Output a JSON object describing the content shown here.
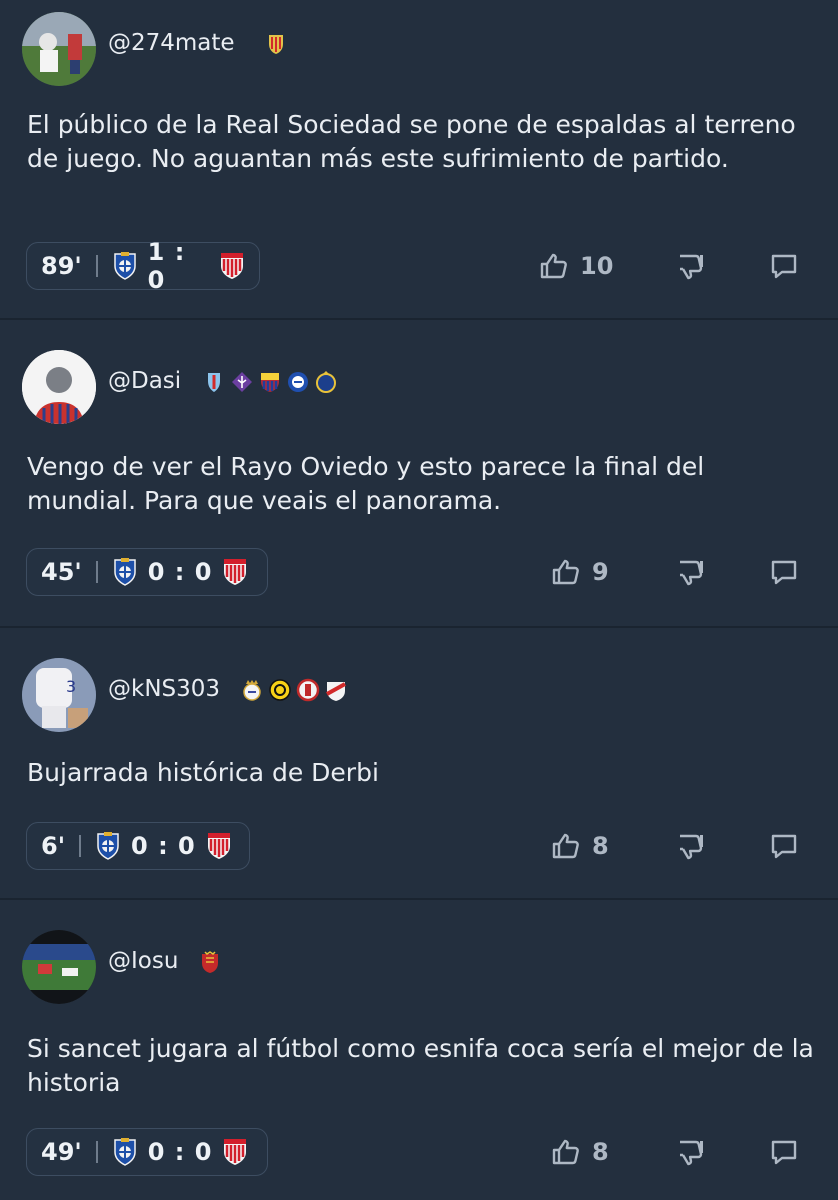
{
  "posts": [
    {
      "username": "@274mate",
      "badges": [
        "sporting-gijon-crest-icon"
      ],
      "text": "El público de la Real Sociedad se pone de espaldas al terreno de juego. No aguantan más este sufrimiento de partido.",
      "minute": "89'",
      "score": "1 : 0",
      "home_crest": "real-sociedad-crest-icon",
      "away_crest": "athletic-club-crest-icon",
      "likes": "10"
    },
    {
      "username": "@Dasi",
      "badges": [
        "celta-crest-icon",
        "fiorentina-crest-icon",
        "barcelona-crest-icon",
        "alaves-crest-icon",
        "union-sg-crest-icon"
      ],
      "text": "Vengo de ver el Rayo Oviedo y esto parece la final del mundial. Para que veais el panorama.",
      "minute": "45'",
      "score": "0 : 0",
      "home_crest": "real-sociedad-crest-icon",
      "away_crest": "athletic-club-crest-icon",
      "likes": "9"
    },
    {
      "username": "@kNS303",
      "badges": [
        "real-madrid-crest-icon",
        "dortmund-crest-icon",
        "st-pauli-crest-icon",
        "rayo-vallecano-crest-icon"
      ],
      "text": "Bujarrada histórica de Derbi",
      "minute": "6'",
      "score": "0 : 0",
      "home_crest": "real-sociedad-crest-icon",
      "away_crest": "athletic-club-crest-icon",
      "likes": "8"
    },
    {
      "username": "@Iosu",
      "badges": [
        "osasuna-crest-icon"
      ],
      "text": "Si sancet jugara al fútbol como esnifa coca sería el mejor de la historia",
      "minute": "49'",
      "score": "0 : 0",
      "home_crest": "real-sociedad-crest-icon",
      "away_crest": "athletic-club-crest-icon",
      "likes": "8"
    }
  ],
  "icons": {
    "like": "thumbs-up-icon",
    "dislike": "thumbs-down-icon",
    "comment": "comment-icon"
  },
  "colors": {
    "background": "#232f3e",
    "text": "#e9edf2",
    "muted": "#aeb8c4",
    "divider": "#1a2430"
  }
}
